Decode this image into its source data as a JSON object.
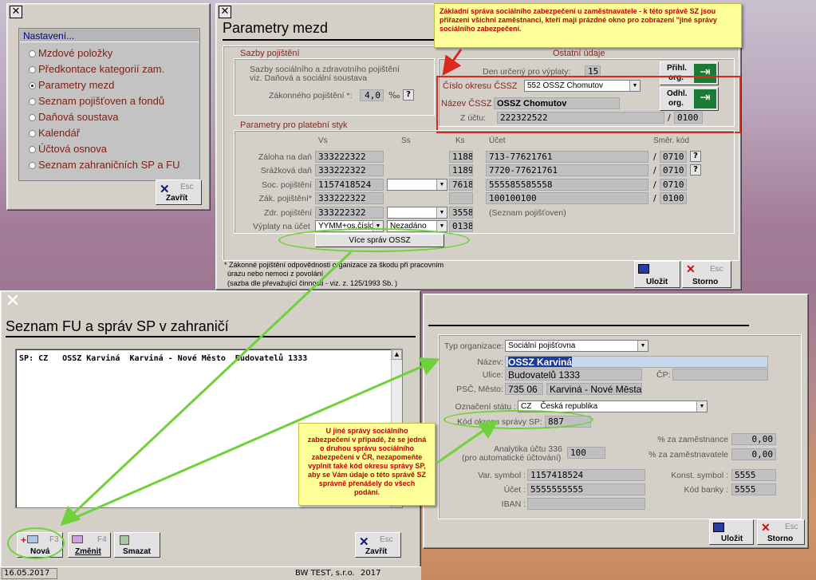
{
  "settings": {
    "title": "Nastavení...",
    "items": [
      "Mzdové položky",
      "Předkontace kategorií zam.",
      "Parametry mezd",
      "Seznam pojišťoven a fondů",
      "Daňová soustava",
      "Kalendář",
      "Účtová osnova",
      "Seznam zahraničních SP a FU"
    ],
    "selected_index": 2,
    "close_key": "Esc",
    "close_label": "Zavřít"
  },
  "params": {
    "title": "Parametry mezd",
    "sazby_label": "Sazby pojištění",
    "sazby_note1": "Sazby sociálního a zdravotního pojištění",
    "sazby_note2": "viz. Daňová a sociální soustava",
    "zakonne_label": "Zákonného pojištění *:",
    "zakonne_value": "4,0",
    "zakonne_unit": "‰",
    "ostatni_label": "Ostatní údaje",
    "den_label": "Den určený pro výplaty:",
    "den_value": "15",
    "prihl_label1": "Přihl.",
    "prihl_label2": "org.",
    "odhl_label1": "Odhl.",
    "odhl_label2": "org.",
    "cislo_okresu_label": "Číslo okresu ČSSZ",
    "cislo_okresu_value": "552  OSSZ Chomutov",
    "nazev_cssz_label": "Název ČSSZ",
    "nazev_cssz_value": "OSSZ Chomutov",
    "z_uctu_label": "Z účtu:",
    "z_uctu_value": "222322522",
    "z_uctu_bank": "0100",
    "platebni_label": "Parametry pro platební styk",
    "col_vs": "Vs",
    "col_ss": "Ss",
    "col_ks": "Ks",
    "col_ucet": "Účet",
    "col_smer": "Směr. kód",
    "rows": [
      {
        "label": "Záloha na daň",
        "vs": "333222322",
        "ss": "",
        "ks": "1188",
        "ucet": "713-77621761",
        "smer": "0710"
      },
      {
        "label": "Srážková daň",
        "vs": "333222322",
        "ss": "",
        "ks": "1189",
        "ucet": "7720-77621761",
        "smer": "0710"
      },
      {
        "label": "Soc. pojištění",
        "vs": "1157418524",
        "ss": "",
        "ks": "7618",
        "ucet": "555585585558",
        "smer": "0710"
      },
      {
        "label": "Zák. pojištění*",
        "vs": "333222322",
        "ss": "",
        "ks": "",
        "ucet": "100100100",
        "smer": "0100"
      },
      {
        "label": "Zdr. pojištění",
        "vs": "333222322",
        "ss": "",
        "ks": "3558",
        "ucet": "(Seznam pojišťoven)",
        "smer": ""
      }
    ],
    "vyplaty_label": "Výplaty na účet",
    "vyplaty_vs": "YYMM+os.číslo",
    "vyplaty_ss": "Nezadáno",
    "vyplaty_ks": "0138",
    "vice_button": "Více správ OSSZ",
    "footnote1": "* Zákonné pojištění odpovědnosti organizace za škodu při pracovním",
    "footnote2": "úrazu nebo nemoci z povolání",
    "footnote3": "(sazba dle převažující činnosti - viz. z. 125/1993 Sb. )",
    "save_label": "Uložit",
    "storno_key": "Esc",
    "storno_label": "Storno"
  },
  "note_top": "Základní správa sociálního zabezpečení u zaměstnavatele - k této správě SZ jsou přiřazeni všichni zaměstnanci, kteří mají prázdné okno pro zobrazení \"jiné správy sociálního zabezpečení.",
  "list": {
    "title": "Seznam FU a správ SP v zahraničí",
    "row": "SP: CZ   OSSZ Karviná  Karviná - Nové Město  Budovatelů 1333",
    "new_key": "F3",
    "new_label": "Nová",
    "change_key": "F4",
    "change_label": "Změnit",
    "delete_label": "Smazat",
    "close_key": "Esc",
    "close_label": "Zavřít"
  },
  "detail": {
    "typ_label": "Typ organizace:",
    "typ_value": "Sociální pojišťovna",
    "nazev_label": "Název:",
    "nazev_value": "OSSZ Karviná",
    "ulice_label": "Ulice:",
    "ulice_value": "Budovatelů 1333",
    "cp_label": "ČP:",
    "psc_label": "PSČ, Město:",
    "psc_value": "735 06",
    "mesto_value": "Karviná - Nové Města",
    "stat_label": "Označení státu :",
    "stat_value": "CZ    Česká republika",
    "kod_label": "Kód okresu správy SP:",
    "kod_value": "887",
    "analytika_label1": "Analytika účtu 336",
    "analytika_label2": "(pro automatické účtování)",
    "analytika_value": "100",
    "pz_label": "% za zaměstnance",
    "pz_value": "0,00",
    "pzl_label": "% za zaměstnavatele",
    "pzl_value": "0,00",
    "var_label": "Var. symbol :",
    "var_value": "1157418524",
    "konst_label": "Konst. symbol :",
    "konst_value": "5555",
    "ucet_label": "Účet :",
    "ucet_value": "5555555555",
    "kod_banky_label": "Kód banky :",
    "kod_banky_value": "5555",
    "iban_label": "IBAN :",
    "save_label": "Uložit",
    "storno_key": "Esc",
    "storno_label": "Storno"
  },
  "note_bottom": "U jiné správy sociálního zabezpečení v případě, že se jedná o druhou správu sociálního zabezpečení v ČR, nezapomeňte vyplnit také kód okresu správy SP, aby se Vám údaje o této správě SZ správně přenášely do všech podání.",
  "status": {
    "date": "16.05.2017",
    "company": "BW TEST, s.r.o.",
    "year": "2017"
  }
}
